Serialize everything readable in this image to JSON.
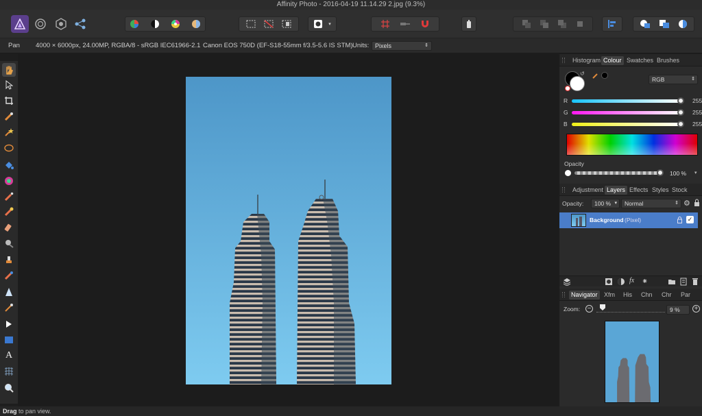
{
  "window": {
    "title": "Affinity Photo - 2016-04-19 11.14.29 2.jpg (9.3%)"
  },
  "context": {
    "tool_name": "Pan",
    "doc_info": "4000 × 6000px, 24.00MP, RGBA/8 - sRGB IEC61966-2.1",
    "camera": "Canon EOS 750D (EF-S18-55mm f/3.5-5.6 IS STM)",
    "units_label": "Units:",
    "units_value": "Pixels"
  },
  "colour_panel": {
    "tabs": [
      "Histogram",
      "Colour",
      "Swatches",
      "Brushes"
    ],
    "active_tab": "Colour",
    "model": "RGB",
    "r_label": "R",
    "r_value": "255",
    "g_label": "G",
    "g_value": "255",
    "b_label": "B",
    "b_value": "255",
    "opacity_label": "Opacity",
    "opacity_value": "100 %"
  },
  "layers_panel": {
    "tabs": [
      "Adjustment",
      "Layers",
      "Effects",
      "Styles",
      "Stock"
    ],
    "active_tab": "Layers",
    "opacity_label": "Opacity:",
    "opacity_value": "100 %",
    "blend_mode": "Normal",
    "layer_name": "Background",
    "layer_type": "(Pixel)"
  },
  "navigator_panel": {
    "tabs": [
      "Navigator",
      "Xfm",
      "His",
      "Chn",
      "Chr",
      "Par"
    ],
    "active_tab": "Navigator",
    "zoom_label": "Zoom:",
    "zoom_value": "9 %"
  },
  "status": {
    "bold": "Drag",
    "text": " to pan view."
  },
  "colors": {
    "accent": "#4a7dc9",
    "sky_top": "#4d96c8",
    "sky_bottom": "#7ecbf0"
  }
}
